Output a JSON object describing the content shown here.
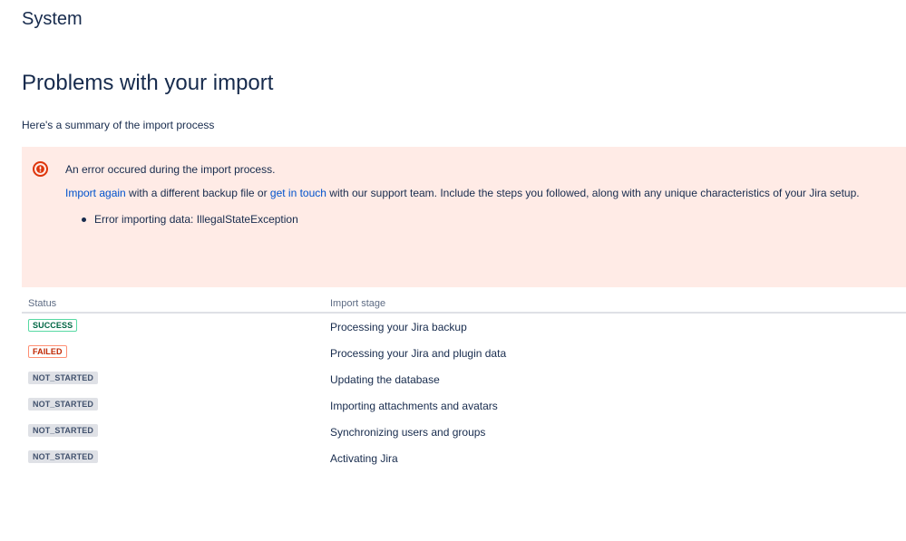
{
  "header": {
    "title": "System"
  },
  "main": {
    "title": "Problems with your import",
    "summary": "Here's a summary of the import process"
  },
  "error": {
    "icon": "error-icon",
    "heading": "An error occured during the import process.",
    "import_again_link": "Import again",
    "text_1": " with a different backup file or ",
    "get_in_touch_link": "get in touch",
    "text_2": " with our support team. Include the steps you followed, along with any unique characteristics of your Jira setup.",
    "details": [
      "Error importing data: IllegalStateException"
    ],
    "colors": {
      "background": "#ffebe6",
      "icon": "#de350b",
      "link": "#0052cc"
    }
  },
  "stages": {
    "headers": {
      "status": "Status",
      "stage": "Import stage"
    },
    "rows": [
      {
        "status": "SUCCESS",
        "stage": "Processing your Jira backup"
      },
      {
        "status": "FAILED",
        "stage": "Processing your Jira and plugin data"
      },
      {
        "status": "NOT_STARTED",
        "stage": "Updating the database"
      },
      {
        "status": "NOT_STARTED",
        "stage": "Importing attachments and avatars"
      },
      {
        "status": "NOT_STARTED",
        "stage": "Synchronizing users and groups"
      },
      {
        "status": "NOT_STARTED",
        "stage": "Activating Jira"
      }
    ],
    "status_colors": {
      "SUCCESS": "#006644",
      "FAILED": "#bf2600",
      "NOT_STARTED": "#42526e"
    }
  }
}
